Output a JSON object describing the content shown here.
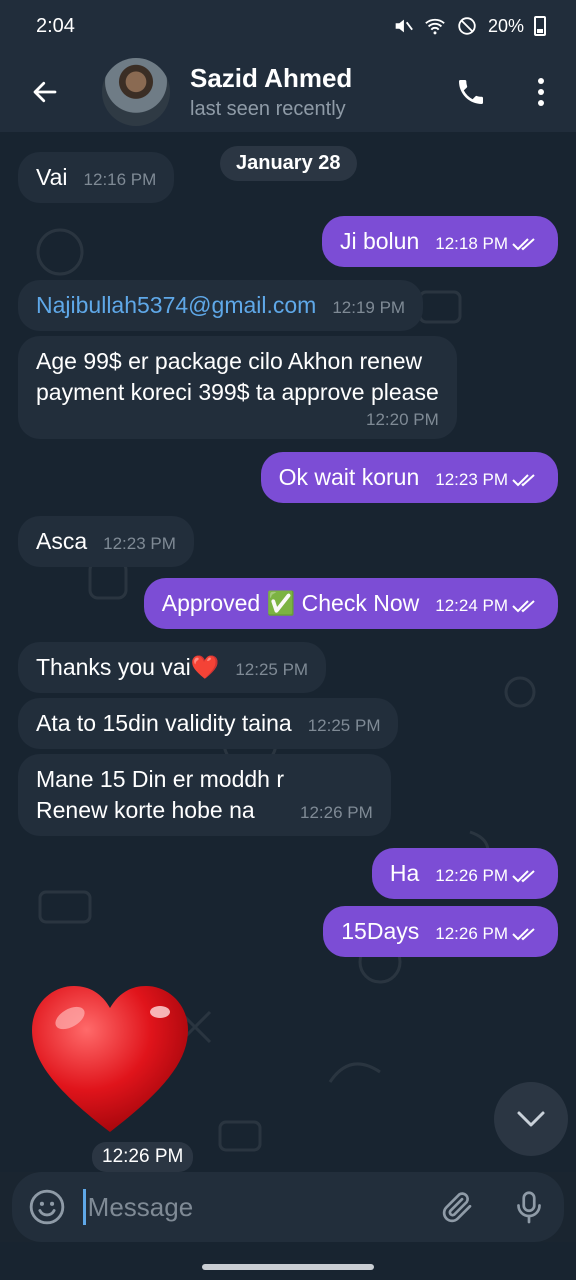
{
  "status_bar": {
    "time": "2:04",
    "battery": "20%"
  },
  "header": {
    "name": "Sazid Ahmed",
    "status": "last seen recently"
  },
  "chat": {
    "date_label": "January 28",
    "messages": [
      {
        "dir": "in",
        "text": "Vai",
        "time": "12:16 PM"
      },
      {
        "dir": "out",
        "text": "Ji bolun",
        "time": "12:18 PM"
      },
      {
        "dir": "in",
        "text": "Najibullah5374@gmail.com",
        "time": "12:19 PM"
      },
      {
        "dir": "in",
        "text": "Age 99$ er package cilo Akhon renew\npayment koreci 399$ ta approve please",
        "time": "12:20 PM"
      },
      {
        "dir": "out",
        "text": "Ok wait korun",
        "time": "12:23 PM"
      },
      {
        "dir": "in",
        "text": "Asca",
        "time": "12:23 PM"
      },
      {
        "dir": "out",
        "text": "Approved ✅ Check Now",
        "time": "12:24 PM"
      },
      {
        "dir": "in",
        "text": "Thanks you vai❤️",
        "time": "12:25 PM"
      },
      {
        "dir": "in",
        "text": "Ata to 15din validity taina",
        "time": "12:25 PM"
      },
      {
        "dir": "in",
        "text": "Mane 15 Din er moddh r\nRenew korte hobe na",
        "time": "12:26 PM"
      },
      {
        "dir": "out",
        "text": "Ha",
        "time": "12:26 PM"
      },
      {
        "dir": "out",
        "text": "15Days",
        "time": "12:26 PM"
      }
    ],
    "sticker": {
      "icon": "red-heart-sticker",
      "time": "12:26 PM"
    }
  },
  "composer": {
    "placeholder": "Message"
  },
  "colors": {
    "outgoing": "#7c4dd5",
    "incoming": "#222e3b",
    "link": "#5fa8e8",
    "background": "#182430"
  }
}
